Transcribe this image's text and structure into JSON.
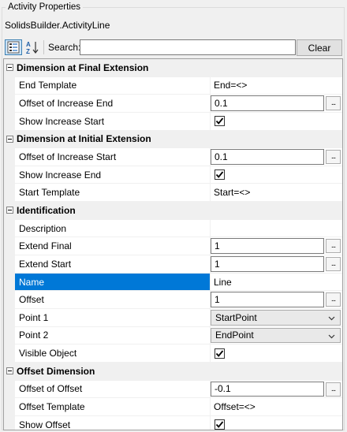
{
  "groupbox_title": "Activity Properties",
  "object_name": "SolidsBuilder.ActivityLine",
  "toolbar": {
    "categorized_icon": "categorized-view-icon",
    "alphabetical_icon": "sort-alpha-icon",
    "search_label": "Search:",
    "search_value": "",
    "clear_label": "Clear"
  },
  "categories": [
    {
      "title": "Dimension at Final Extension"
    },
    {
      "title": "Dimension at Initial Extension"
    },
    {
      "title": "Identification"
    },
    {
      "title": "Offset Dimension"
    }
  ],
  "props": {
    "end_template": {
      "name": "End Template",
      "value": "End=<>"
    },
    "offset_inc_end": {
      "name": "Offset of Increase End",
      "value": "0.1"
    },
    "show_inc_start": {
      "name": "Show Increase Start",
      "checked": true
    },
    "offset_inc_start": {
      "name": "Offset of Increase Start",
      "value": "0.1"
    },
    "show_inc_end": {
      "name": "Show Increase End",
      "checked": true
    },
    "start_template": {
      "name": "Start Template",
      "value": "Start=<>"
    },
    "description": {
      "name": "Description",
      "value": ""
    },
    "extend_final": {
      "name": "Extend Final",
      "value": "1"
    },
    "extend_start": {
      "name": "Extend Start",
      "value": "1"
    },
    "name": {
      "name": "Name",
      "value": "Line"
    },
    "offset": {
      "name": "Offset",
      "value": "1"
    },
    "point1": {
      "name": "Point 1",
      "value": "StartPoint"
    },
    "point2": {
      "name": "Point 2",
      "value": "EndPoint"
    },
    "visible_object": {
      "name": "Visible Object",
      "checked": true
    },
    "offset_of_offset": {
      "name": "Offset of Offset",
      "value": "-0.1"
    },
    "offset_template": {
      "name": "Offset Template",
      "value": "Offset=<>"
    },
    "show_offset": {
      "name": "Show Offset",
      "checked": true
    }
  },
  "ellipsis_label": "...",
  "colors": {
    "selection": "#0078d7",
    "category_bg": "#f0f0f0"
  }
}
